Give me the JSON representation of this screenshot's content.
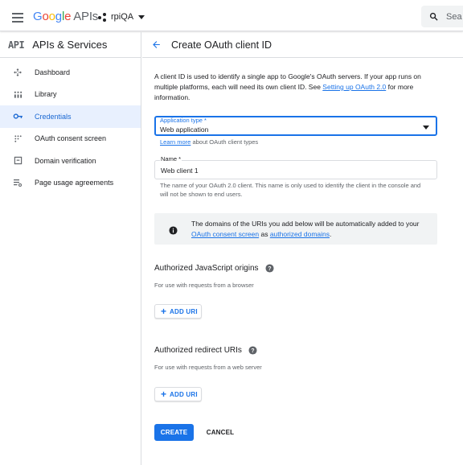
{
  "topbar": {
    "logo": {
      "g1": "G",
      "o1": "o",
      "o2": "o",
      "g2": "g",
      "l": "l",
      "e": "e",
      "apis": "APIs"
    },
    "project": "rpiQA",
    "search_placeholder": "Sea"
  },
  "sidebar": {
    "title": "APIs & Services",
    "api_mark": "API",
    "items": [
      {
        "label": "Dashboard",
        "icon": "dashboard-icon"
      },
      {
        "label": "Library",
        "icon": "library-icon"
      },
      {
        "label": "Credentials",
        "icon": "key-icon",
        "active": true
      },
      {
        "label": "OAuth consent screen",
        "icon": "consent-icon"
      },
      {
        "label": "Domain verification",
        "icon": "domain-icon"
      },
      {
        "label": "Page usage agreements",
        "icon": "settings-list-icon"
      }
    ]
  },
  "main": {
    "title": "Create OAuth client ID",
    "intro": {
      "text": "A client ID is used to identify a single app to Google's OAuth servers. If your app runs on multiple platforms, each will need its own client ID. See ",
      "link": "Setting up OAuth 2.0",
      "suffix": " for more information."
    },
    "app_type": {
      "label": "Application type *",
      "value": "Web application",
      "learn_link": "Learn more",
      "learn_suffix": " about OAuth client types"
    },
    "name_field": {
      "label": "Name *",
      "value": "Web client 1",
      "hint": "The name of your OAuth 2.0 client. This name is only used to identify the client in the console and will not be shown to end users."
    },
    "info": {
      "text1": "The domains of the URIs you add below will be automatically added to your ",
      "link1": "OAuth consent screen",
      "text2": " as ",
      "link2": "authorized domains",
      "text3": "."
    },
    "js_origins": {
      "title": "Authorized JavaScript origins",
      "sub": "For use with requests from a browser",
      "add_label": "ADD URI"
    },
    "redirect_uris": {
      "title": "Authorized redirect URIs",
      "sub": "For use with requests from a web server",
      "add_label": "ADD URI"
    },
    "create_label": "CREATE",
    "cancel_label": "CANCEL"
  },
  "colors": {
    "accent": "#1a73e8",
    "active_bg": "#e8f0fe",
    "active_text": "#1967d2"
  }
}
